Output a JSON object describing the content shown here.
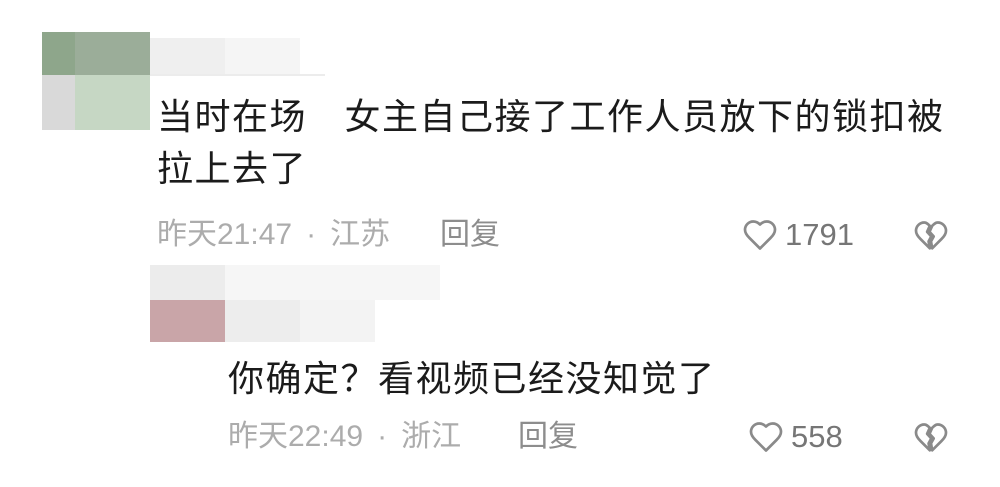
{
  "colors": {
    "background": "#ffffff",
    "text": "#1b1b1b",
    "meta": "#acacac",
    "action": "#8d8d8d",
    "count": "#767676",
    "icon": "#8a8a8a"
  },
  "icons": {
    "like": "heart-outline-icon",
    "dislike": "broken-heart-icon"
  },
  "comment": {
    "text": "当时在场　女主自己接了工作人员放下的锁扣被拉上去了",
    "time": "昨天21:47",
    "separator": "·",
    "location": "江苏",
    "reply_label": "回复",
    "likes": "1791"
  },
  "reply": {
    "text": "你确定？看视频已经没知觉了",
    "time": "昨天22:49",
    "separator": "·",
    "location": "浙江",
    "reply_label": "回复",
    "likes": "558"
  }
}
